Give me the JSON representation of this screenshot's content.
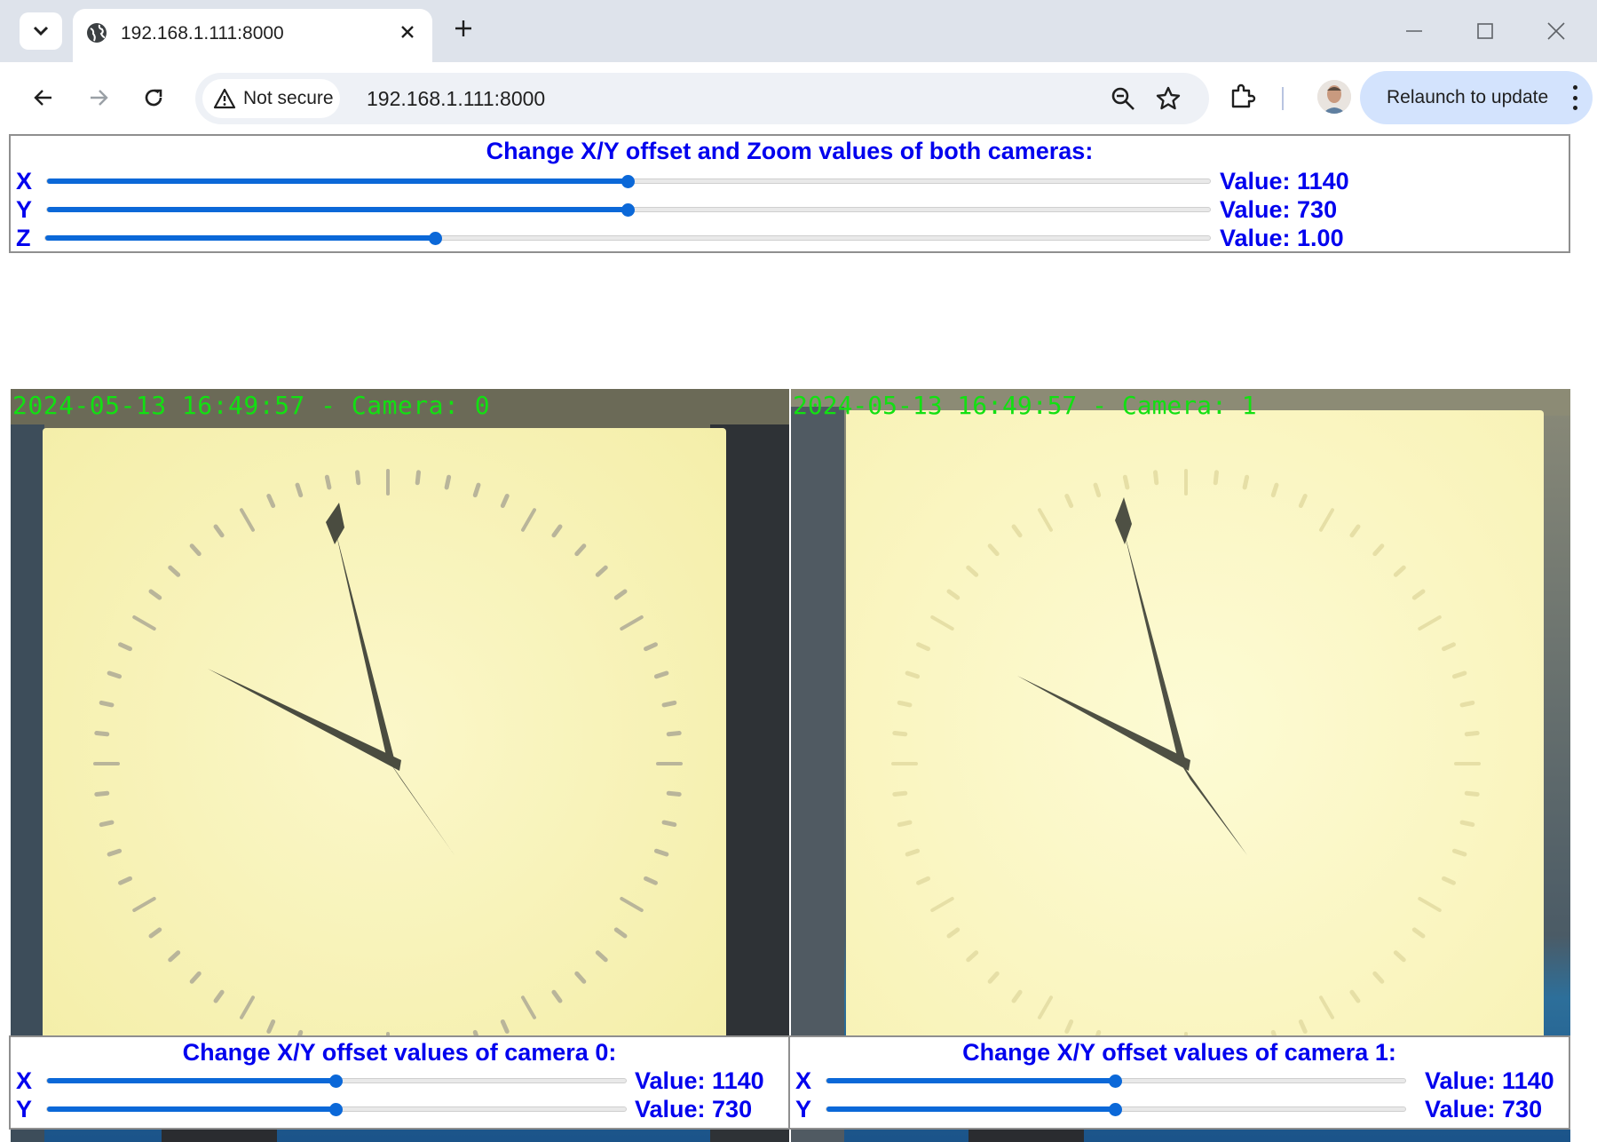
{
  "browser": {
    "tab_title": "192.168.1.111:8000",
    "security_label": "Not secure",
    "url": "192.168.1.111:8000",
    "relaunch_label": "Relaunch to update"
  },
  "global_panel": {
    "title": "Change X/Y offset and Zoom values of both cameras:",
    "sliders": [
      {
        "label": "X",
        "value_text": "Value: 1140",
        "fraction": 0.5
      },
      {
        "label": "Y",
        "value_text": "Value: 730",
        "fraction": 0.5
      },
      {
        "label": "Z",
        "value_text": "Value: 1.00",
        "fraction": 0.335
      }
    ]
  },
  "cameras": [
    {
      "overlay": "2024-05-13 16:49:57 - Camera: 0"
    },
    {
      "overlay": "2024-05-13 16:49:57 - Camera: 1"
    }
  ],
  "camera_panels": [
    {
      "title": "Change X/Y offset values of camera 0:",
      "sliders": [
        {
          "label": "X",
          "value_text": "Value: 1140",
          "fraction": 0.5
        },
        {
          "label": "Y",
          "value_text": "Value: 730",
          "fraction": 0.5
        }
      ]
    },
    {
      "title": "Change X/Y offset values of camera 1:",
      "sliders": [
        {
          "label": "X",
          "value_text": "Value: 1140",
          "fraction": 0.5
        },
        {
          "label": "Y",
          "value_text": "Value: 730",
          "fraction": 0.5
        }
      ]
    }
  ],
  "colors": {
    "label_blue": "#0000ee",
    "slider_blue": "#0b68d8",
    "overlay_green": "#12e012",
    "relaunch_bg": "#d3e3fd"
  },
  "icons": [
    "tab-search-icon",
    "globe-icon",
    "close-icon",
    "plus-icon",
    "minimize-icon",
    "maximize-icon",
    "back-icon",
    "forward-icon",
    "reload-icon",
    "warning-icon",
    "zoom-icon",
    "star-icon",
    "extensions-icon",
    "more-icon"
  ]
}
